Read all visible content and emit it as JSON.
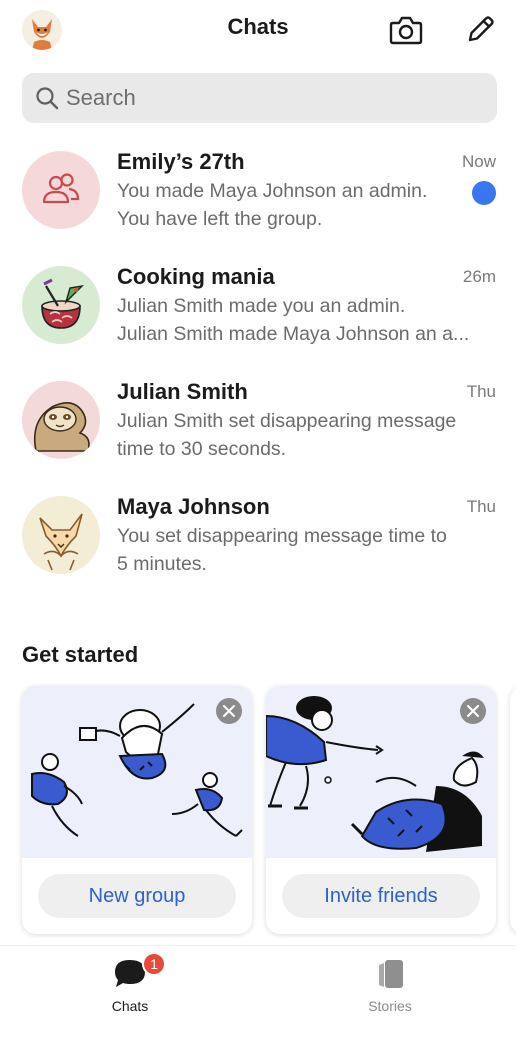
{
  "header": {
    "title": "Chats",
    "avatar_icon": "fox-avatar-icon",
    "camera_icon": "camera-icon",
    "compose_icon": "pencil-icon"
  },
  "search": {
    "placeholder": "Search",
    "icon": "search-icon"
  },
  "chats": [
    {
      "name": "Emily’s 27th",
      "time": "Now",
      "line1": "You made Maya Johnson an admin.",
      "line2": "You have left the group.",
      "unread": true,
      "avatar": "group-icon"
    },
    {
      "name": "Cooking mania",
      "time": "26m",
      "line1": "Julian Smith made you an admin.",
      "line2": "Julian Smith made Maya Johnson an a...",
      "unread": false,
      "avatar": "coconut-drink-avatar"
    },
    {
      "name": "Julian Smith",
      "time": "Thu",
      "line1": "Julian  Smith set disappearing message",
      "line2": "time to 30 seconds.",
      "unread": false,
      "avatar": "sloth-avatar"
    },
    {
      "name": "Maya Johnson",
      "time": "Thu",
      "line1": "You set disappearing message time to",
      "line2": "5 minutes.",
      "unread": false,
      "avatar": "fox-sketch-avatar"
    }
  ],
  "get_started": {
    "title": "Get started",
    "cards": [
      {
        "button": "New group",
        "art": "people-jumping-illustration"
      },
      {
        "button": "Invite friends",
        "art": "people-reaching-illustration"
      }
    ]
  },
  "tabs": [
    {
      "label": "Chats",
      "icon": "chat-bubble-icon",
      "badge": "1",
      "active": true
    },
    {
      "label": "Stories",
      "icon": "stories-icon",
      "active": false
    }
  ],
  "colors": {
    "accent": "#3a76f0",
    "badge": "#e64a3b",
    "link": "#2d5fd7"
  }
}
